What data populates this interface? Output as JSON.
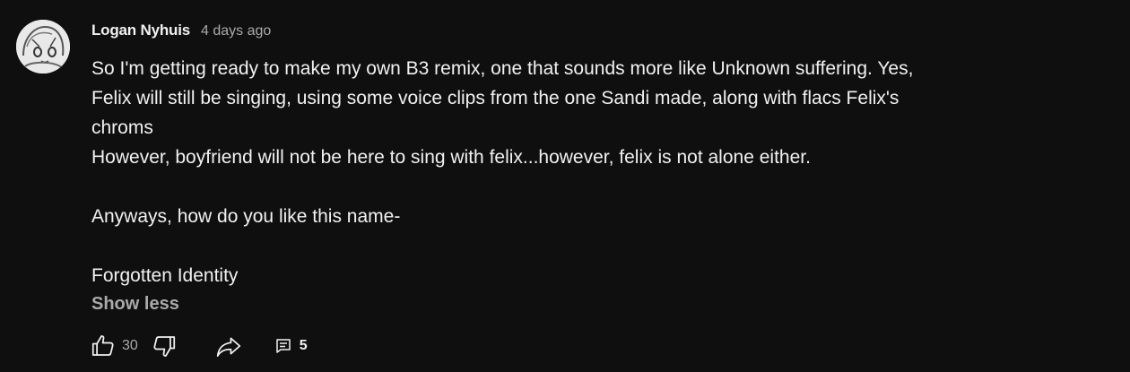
{
  "comment": {
    "author": "Logan Nyhuis",
    "timestamp": "4 days ago",
    "lines": [
      "So I'm getting ready to make my own B3 remix, one that sounds more like Unknown suffering. Yes,",
      "Felix will still be singing, using some voice clips from the one Sandi made, along with flacs Felix's",
      "chroms",
      "However, boyfriend will not be here to sing with felix...however, felix is not alone either.",
      "",
      "Anyways, how do you like this name-",
      "",
      "Forgotten Identity"
    ],
    "show_less_label": "Show less",
    "like_count": "30",
    "reply_count": "5"
  },
  "icons": {
    "like": "thumbs-up-icon",
    "dislike": "thumbs-down-icon",
    "share": "share-arrow-icon",
    "replies": "comment-icon"
  }
}
